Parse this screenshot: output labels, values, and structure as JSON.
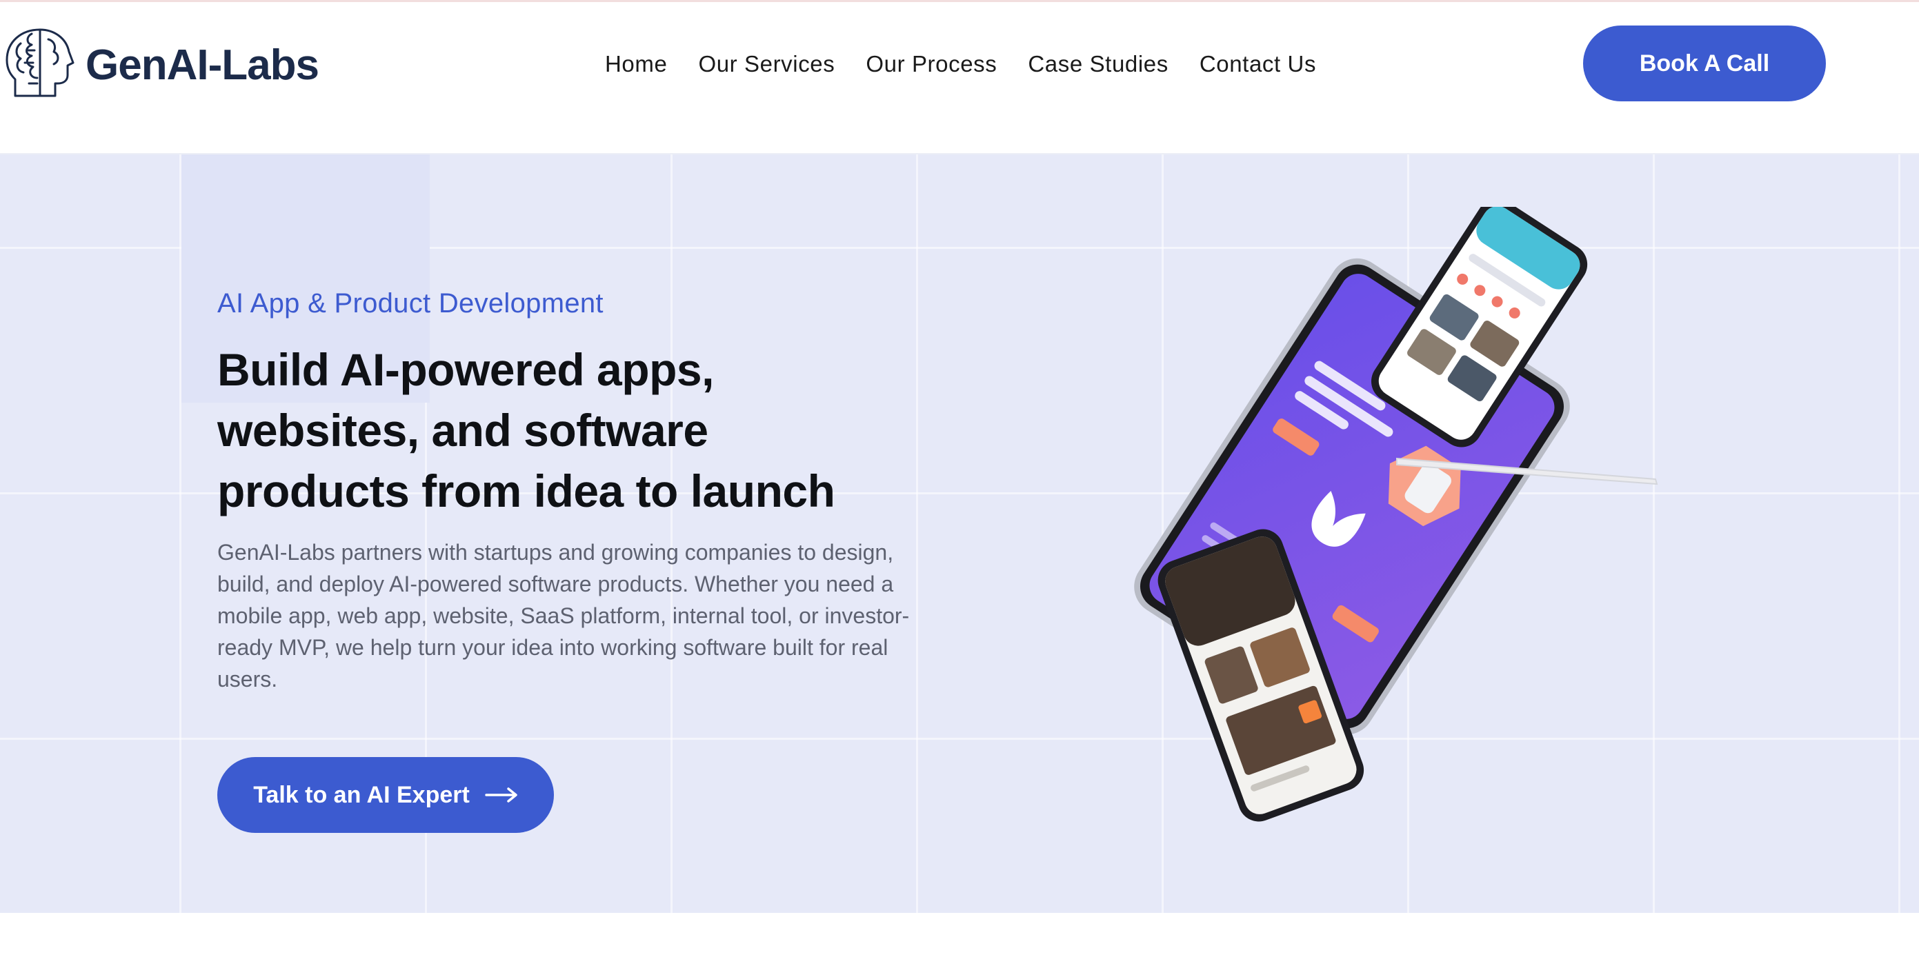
{
  "brand": {
    "name": "GenAI-Labs",
    "logo_icon": "brain-head-icon"
  },
  "nav": {
    "items": [
      {
        "label": "Home"
      },
      {
        "label": "Our Services"
      },
      {
        "label": "Our Process"
      },
      {
        "label": "Case Studies"
      },
      {
        "label": "Contact Us"
      }
    ]
  },
  "header": {
    "cta_label": "Book A Call"
  },
  "hero": {
    "eyebrow": "AI App & Product Development",
    "headline_lines": [
      "Build AI-powered apps,",
      "websites, and software",
      "products from idea to launch"
    ],
    "body": "GenAI-Labs partners with startups and growing companies to design, build, and deploy AI-powered software products. Whether you need a mobile app, web app, website, SaaS platform, internal tool, or investor-ready MVP, we help turn your idea into working software built for real users.",
    "cta_label": "Talk to an AI Expert",
    "cta_icon": "arrow-right-icon",
    "illustration_icon": "devices-mockup-icon"
  },
  "colors": {
    "accent": "#3c5bd0",
    "brand_text": "#1c2b4a",
    "hero_bg": "#e6e9f8",
    "device_screen": "#7b4fe0"
  }
}
